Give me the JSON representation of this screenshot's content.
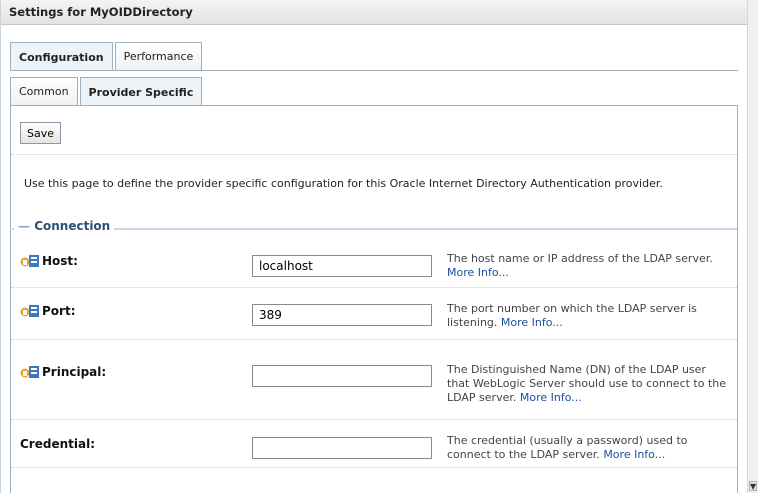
{
  "panel": {
    "title": "Settings for MyOIDDirectory"
  },
  "tabs": [
    {
      "label": "Configuration",
      "active": true
    },
    {
      "label": "Performance",
      "active": false
    }
  ],
  "subtabs": [
    {
      "label": "Common",
      "active": false
    },
    {
      "label": "Provider Specific",
      "active": true
    }
  ],
  "toolbar": {
    "save_label": "Save"
  },
  "description": "Use this page to define the provider specific configuration for this Oracle Internet Directory Authentication provider.",
  "section": {
    "title": "Connection"
  },
  "fields": [
    {
      "label": "Host:",
      "value": "localhost",
      "help": "The host name or IP address of the LDAP server.",
      "more": "More Info...",
      "icon": "lock-warning-icon"
    },
    {
      "label": "Port:",
      "value": "389",
      "help": "The port number on which the LDAP server is listening.",
      "more": "More Info...",
      "icon": "lock-warning-icon"
    },
    {
      "label": "Principal:",
      "value": "",
      "help": "The Distinguished Name (DN) of the LDAP user that WebLogic Server should use to connect to the LDAP server.",
      "more": "More Info...",
      "icon": "lock-warning-icon"
    },
    {
      "label": "Credential:",
      "value": "",
      "help": "The credential (usually a password) used to connect to the LDAP server.",
      "more": "More Info...",
      "icon": null
    }
  ],
  "colors": {
    "tab_border": "#9fb0bf",
    "link": "#1d4fa0",
    "section_rule": "#c8d8e8",
    "icon_orange": "#e8a12c",
    "icon_blue": "#3d78c2"
  }
}
